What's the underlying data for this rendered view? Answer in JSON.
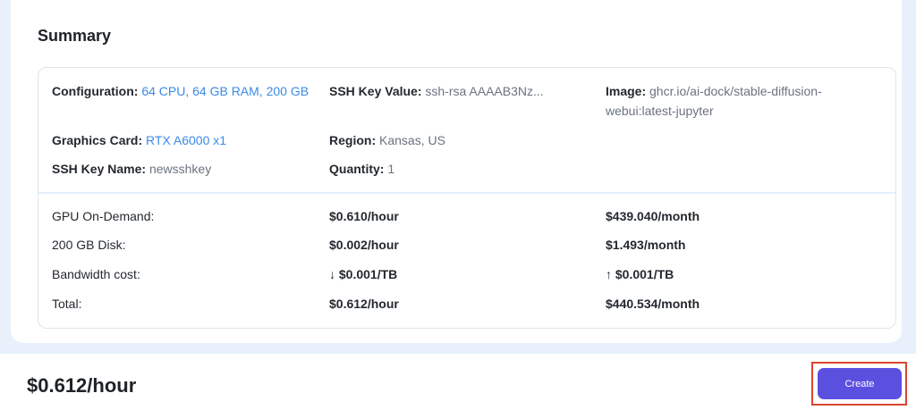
{
  "summary": {
    "title": "Summary",
    "config": {
      "configuration_label": "Configuration:",
      "configuration_value": "64 CPU, 64 GB RAM, 200 GB",
      "ssh_key_value_label": "SSH Key Value:",
      "ssh_key_value": "ssh-rsa AAAAB3Nz...",
      "image_label": "Image:",
      "image_value_line1": "ghcr.io/ai-dock/stable-diffusion-",
      "image_value_line2": "webui:latest-jupyter",
      "graphics_card_label": "Graphics Card:",
      "graphics_card_value": "RTX A6000 x1",
      "region_label": "Region:",
      "region_value": "Kansas, US",
      "ssh_key_name_label": "SSH Key Name:",
      "ssh_key_name_value": "newsshkey",
      "quantity_label": "Quantity:",
      "quantity_value": "1"
    },
    "pricing": [
      {
        "label": "GPU On-Demand:",
        "hourly": "$0.610/hour",
        "monthly": "$439.040/month"
      },
      {
        "label": "200 GB Disk:",
        "hourly": "$0.002/hour",
        "monthly": "$1.493/month"
      },
      {
        "label": "Bandwidth cost:",
        "hourly": "↓ $0.001/TB",
        "monthly": "↑ $0.001/TB"
      },
      {
        "label": "Total:",
        "hourly": "$0.612/hour",
        "monthly": "$440.534/month"
      }
    ]
  },
  "footer": {
    "price": "$0.612/hour",
    "create_label": "Create"
  },
  "colors": {
    "accent": "#5b4fe0",
    "link": "#3b8ae6",
    "highlight": "#d9452f"
  }
}
